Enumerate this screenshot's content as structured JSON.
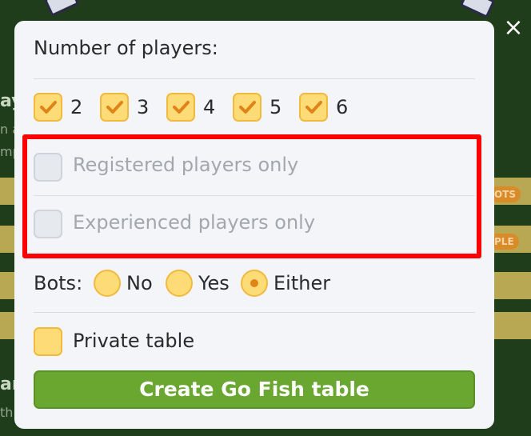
{
  "background": {
    "heading_1": "ay",
    "sub_1": "n a",
    "sub_2": "mp",
    "pill_1": "OTS",
    "pill_2": "PLE",
    "heading_2": "ar",
    "sub_3": "th"
  },
  "close_icon": "×",
  "modal": {
    "players_label": "Number of players:",
    "player_counts": [
      "2",
      "3",
      "4",
      "5",
      "6"
    ],
    "registered_label": "Registered players only",
    "experienced_label": "Experienced players only",
    "bots_label": "Bots:",
    "bots_options": [
      "No",
      "Yes",
      "Either"
    ],
    "bots_selected": "Either",
    "private_label": "Private table",
    "create_button": "Create Go Fish table"
  },
  "colors": {
    "accent_yellow": "#fddc77",
    "check_orange": "#e08418",
    "highlight_red": "#ff0000",
    "button_green": "#6aa731"
  }
}
